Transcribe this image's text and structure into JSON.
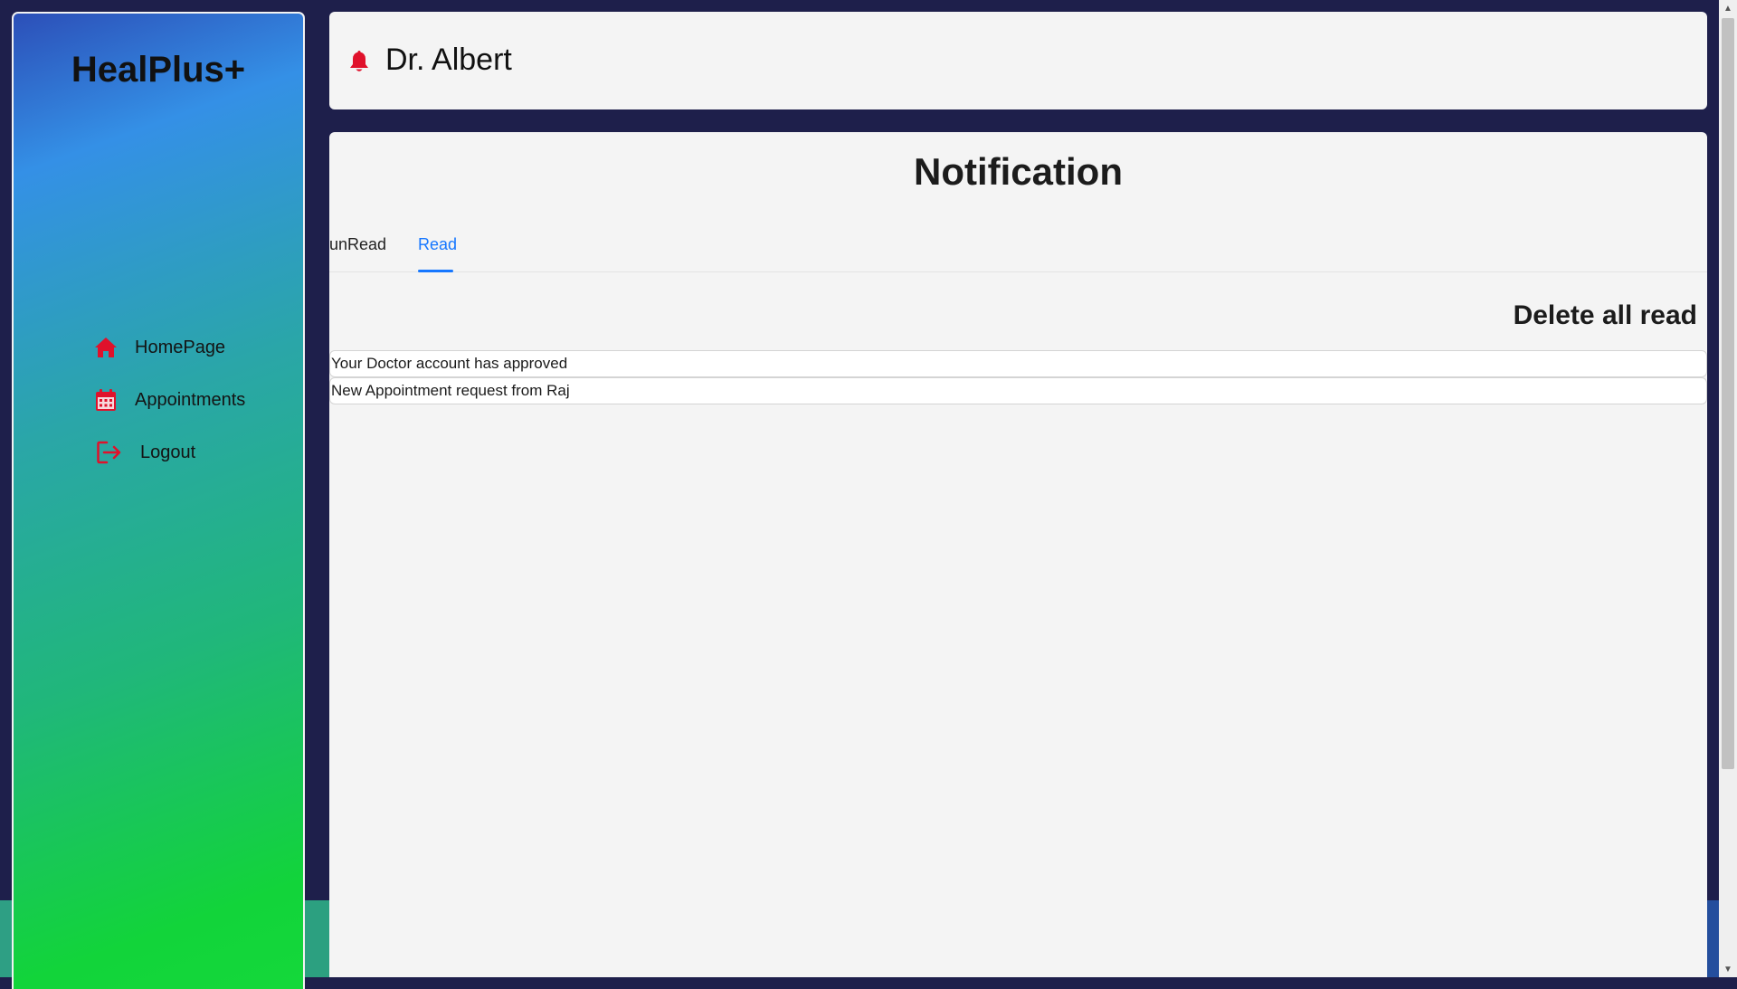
{
  "sidebar": {
    "logo": "HealPlus+",
    "items": [
      {
        "label": "HomePage",
        "icon": "home-icon"
      },
      {
        "label": "Appointments",
        "icon": "calendar-icon"
      },
      {
        "label": "Logout",
        "icon": "logout-icon"
      }
    ]
  },
  "header": {
    "doctor_name": "Dr. Albert",
    "icon": "bell-icon"
  },
  "main": {
    "title": "Notification",
    "tabs": [
      {
        "label": "unRead",
        "active": false
      },
      {
        "label": "Read",
        "active": true
      }
    ],
    "delete_all_label": "Delete all read",
    "notifications": [
      "Your Doctor account has approved",
      "New Appointment request from Raj"
    ]
  },
  "colors": {
    "icon_red": "#e0112b",
    "accent_blue": "#1677ff",
    "page_bg": "#1e1f4b"
  }
}
